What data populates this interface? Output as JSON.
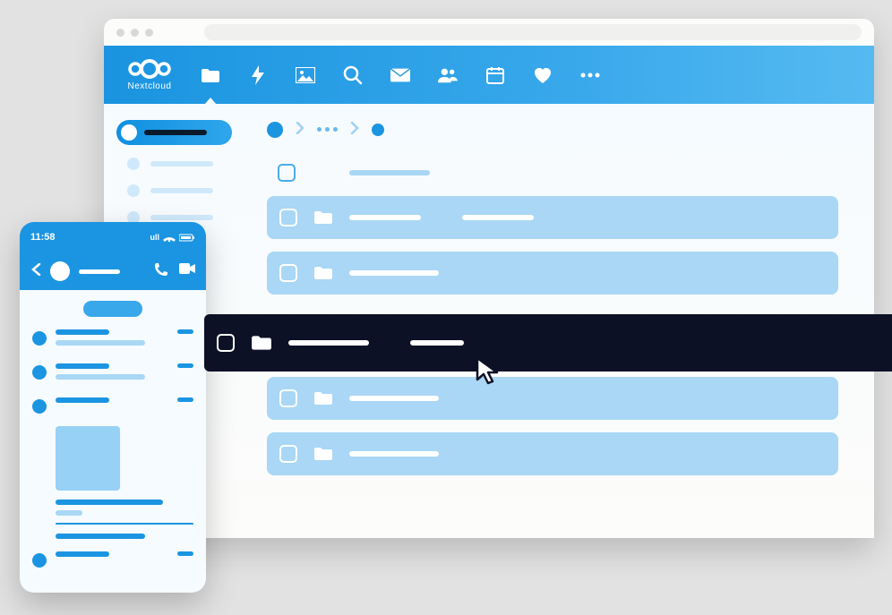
{
  "brand": {
    "name": "Nextcloud"
  },
  "browser": {
    "traffic_lights": 3,
    "url": ""
  },
  "nav": {
    "items": [
      {
        "icon": "folder-icon",
        "active": true
      },
      {
        "icon": "activity-icon",
        "active": false
      },
      {
        "icon": "gallery-icon",
        "active": false
      },
      {
        "icon": "search-icon",
        "active": false
      },
      {
        "icon": "mail-icon",
        "active": false
      },
      {
        "icon": "contacts-icon",
        "active": false
      },
      {
        "icon": "calendar-icon",
        "active": false
      },
      {
        "icon": "favorite-icon",
        "active": false
      },
      {
        "icon": "more-icon",
        "active": false
      }
    ]
  },
  "sidebar": {
    "primary_label": "",
    "items": [
      {
        "label": ""
      },
      {
        "label": ""
      },
      {
        "label": ""
      }
    ]
  },
  "breadcrumb": {
    "segments": 3
  },
  "list": {
    "header_label": "",
    "rows": [
      {
        "name1": "",
        "name2": "",
        "hovered": false
      },
      {
        "name1": "",
        "name2": "",
        "hovered": false
      },
      {
        "name1": "",
        "name2": "",
        "hovered": true
      },
      {
        "name1": "",
        "name2": null,
        "hovered": false
      },
      {
        "name1": "",
        "name2": null,
        "hovered": false
      }
    ]
  },
  "phone": {
    "time": "11:58",
    "signal_label": "ull",
    "date_label": "",
    "messages": [
      {
        "lines": 1
      },
      {
        "lines": 2
      },
      {
        "lines": 2,
        "has_attachment": true
      }
    ],
    "bottom_messages": [
      {
        "lines": 1
      }
    ]
  },
  "colors": {
    "brand_blue": "#1b95e1",
    "row_blue": "#a9d7f5",
    "hover_dark": "#0d1126"
  }
}
